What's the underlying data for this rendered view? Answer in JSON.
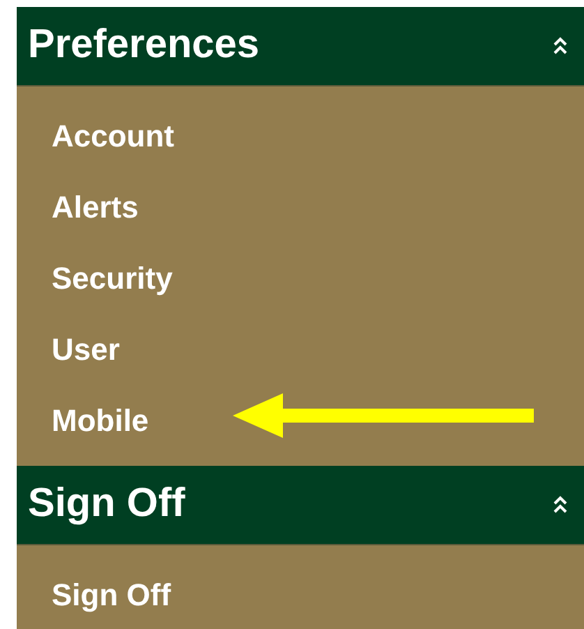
{
  "sections": [
    {
      "title": "Preferences",
      "expanded": true,
      "items": [
        "Account",
        "Alerts",
        "Security",
        "User",
        "Mobile"
      ]
    },
    {
      "title": "Sign Off",
      "expanded": true,
      "items": [
        "Sign Off"
      ]
    }
  ]
}
